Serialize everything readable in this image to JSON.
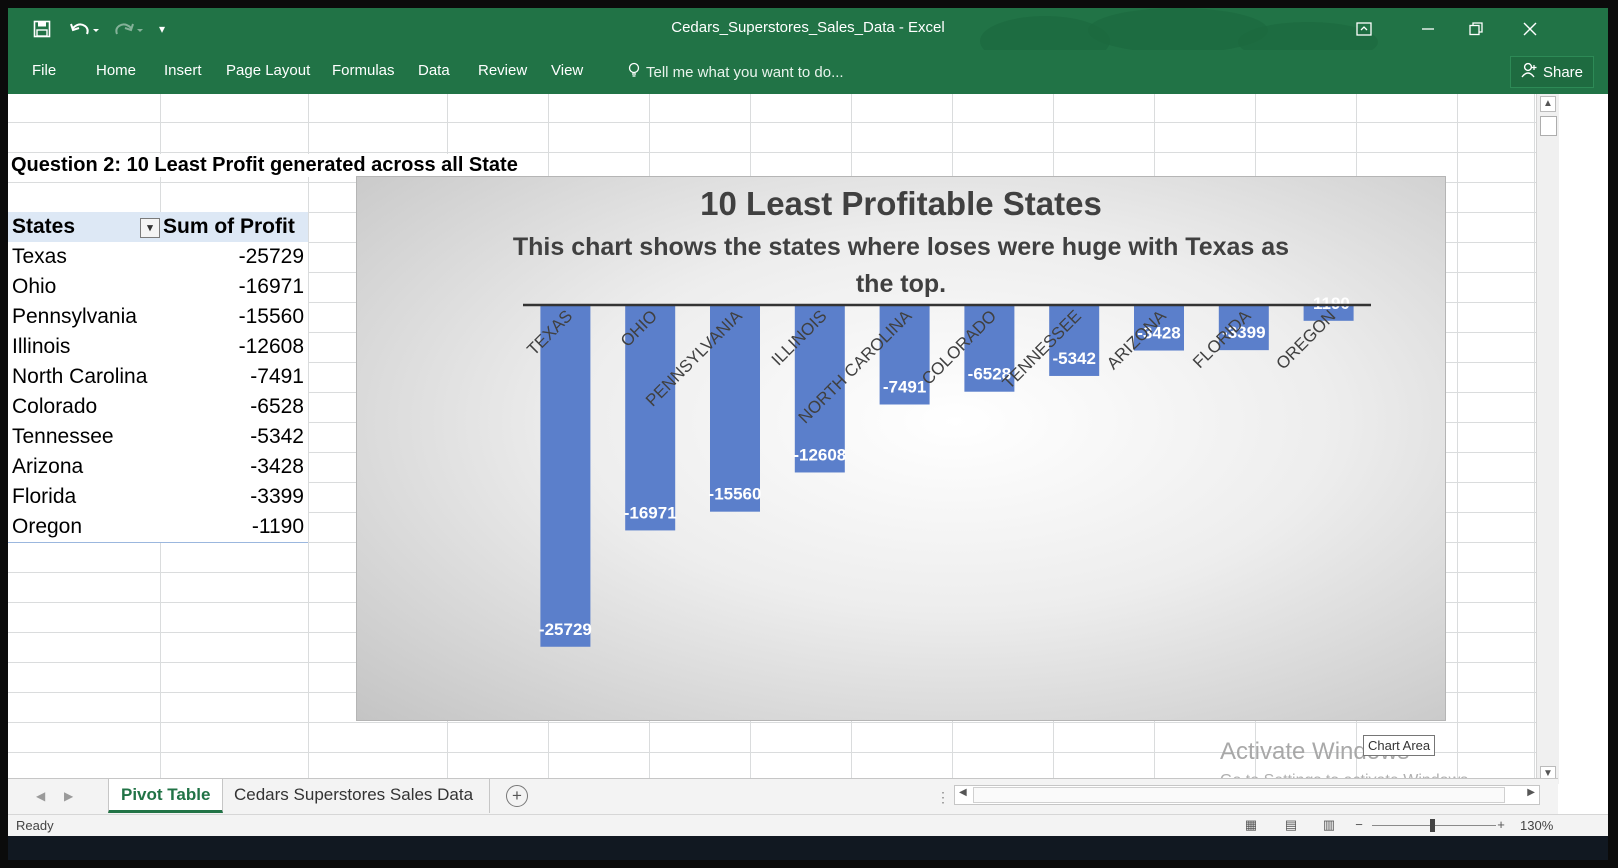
{
  "window": {
    "title": "Cedars_Superstores_Sales_Data - Excel",
    "save_icon": "save-icon",
    "undo_icon": "undo-icon",
    "redo_icon": "redo-icon",
    "customize_icon": "customize-qat-icon"
  },
  "ribbon": {
    "tabs": [
      "File",
      "Home",
      "Insert",
      "Page Layout",
      "Formulas",
      "Data",
      "Review",
      "View"
    ],
    "tell_me": "Tell me what you want to do...",
    "share": "Share"
  },
  "sheet": {
    "question": "Question 2: 10 Least Profit generated across all State",
    "pivot": {
      "col1": "States",
      "col2": "Sum of Profit",
      "rows": [
        {
          "state": "Texas",
          "profit": "-25729"
        },
        {
          "state": "Ohio",
          "profit": "-16971"
        },
        {
          "state": "Pennsylvania",
          "profit": "-15560"
        },
        {
          "state": "Illinois",
          "profit": "-12608"
        },
        {
          "state": "North Carolina",
          "profit": "-7491"
        },
        {
          "state": "Colorado",
          "profit": "-6528"
        },
        {
          "state": "Tennessee",
          "profit": "-5342"
        },
        {
          "state": "Arizona",
          "profit": "-3428"
        },
        {
          "state": "Florida",
          "profit": "-3399"
        },
        {
          "state": "Oregon",
          "profit": "-1190"
        }
      ]
    }
  },
  "chart_data": {
    "type": "bar",
    "title": "10 Least Profitable States",
    "subtitle": "This chart shows the states where loses were huge with Texas as the top.",
    "categories": [
      "TEXAS",
      "OHIO",
      "PENNSYLVANIA",
      "ILLINOIS",
      "NORTH CAROLINA",
      "COLORADO",
      "TENNESSEE",
      "ARIZONA",
      "FLORIDA",
      "OREGON"
    ],
    "values": [
      -25729,
      -16971,
      -15560,
      -12608,
      -7491,
      -6528,
      -5342,
      -3428,
      -3399,
      -1190
    ],
    "ylim": [
      -26500,
      0
    ],
    "grid": false,
    "legend": "none",
    "bar_color": "#5b7fcb",
    "label_color": "#ffffff"
  },
  "overlay": {
    "tooltip": "Chart Area",
    "watermark_line1": "Activate Windows",
    "watermark_line2": "Go to Settings to activate Windows."
  },
  "sheet_tabs": [
    "Pivot Table",
    "Cedars Superstores Sales Data"
  ],
  "status": {
    "text": "Ready",
    "zoom": "130%",
    "zoom_percent": 130
  },
  "colors": {
    "excel_green": "#217346",
    "pivot_header": "#dde8f5"
  }
}
